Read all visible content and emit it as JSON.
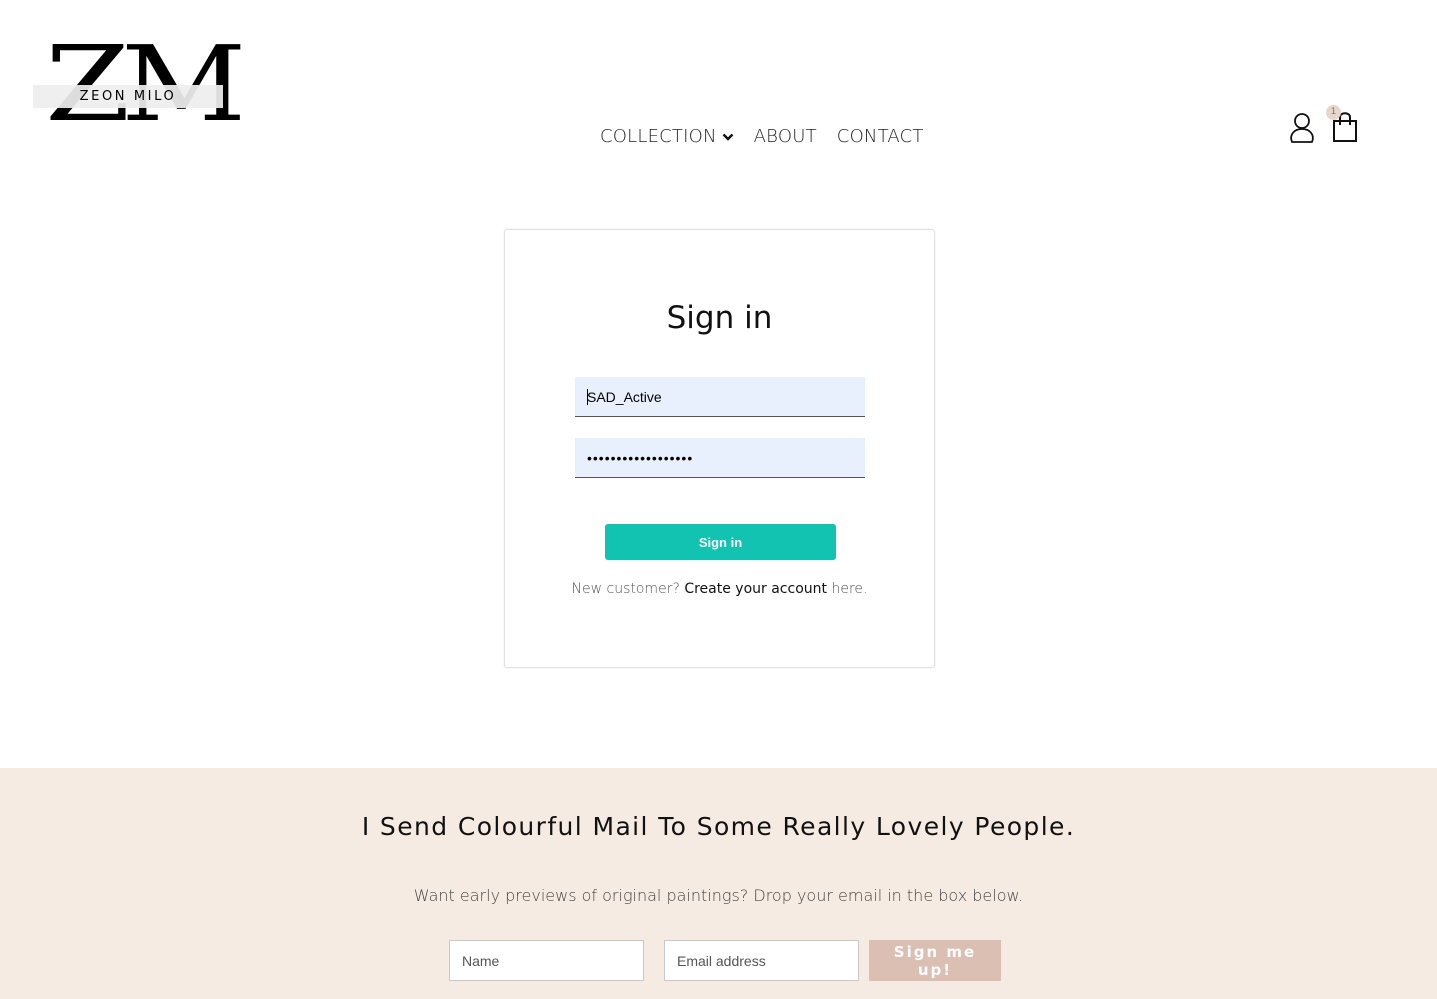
{
  "logo": {
    "letters": "ZM",
    "name": "ZEON MILO"
  },
  "nav": {
    "items": [
      {
        "label": "COLLECTION",
        "has_dropdown": true
      },
      {
        "label": "ABOUT"
      },
      {
        "label": "CONTACT"
      }
    ]
  },
  "header_icons": {
    "account_icon": "user-icon",
    "cart_icon": "shopping-bag-icon",
    "cart_count": "1"
  },
  "signin": {
    "title": "Sign in",
    "username_value": "SAD_Active",
    "password_value": "••••••••••••••••••",
    "button_label": "Sign in",
    "footer_prefix": "New customer?",
    "footer_link": "Create your account",
    "footer_suffix": "here."
  },
  "newsletter": {
    "heading": "I Send Colourful Mail To Some Really Lovely People.",
    "subtext": "Want early previews of original paintings? Drop your email in the box below.",
    "name_placeholder": "Name",
    "email_placeholder": "Email address",
    "button_label": "Sign me up!"
  },
  "colors": {
    "signin_button": "#12c3b1",
    "newsletter_bg": "#f6ebe3",
    "newsletter_button": "#dbbfb2",
    "autofill_field_bg": "#e8f0fe"
  }
}
